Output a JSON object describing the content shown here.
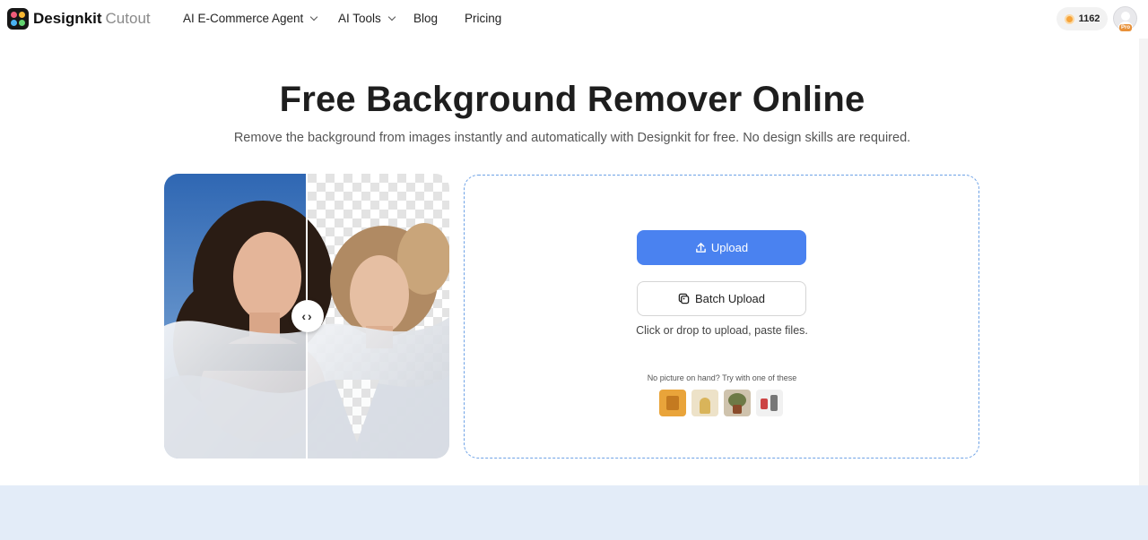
{
  "brand": {
    "name": "Designkit",
    "product": "Cutout"
  },
  "nav": [
    {
      "label": "AI E-Commerce Agent",
      "has_dropdown": true
    },
    {
      "label": "AI Tools",
      "has_dropdown": true
    },
    {
      "label": "Blog",
      "has_dropdown": false
    },
    {
      "label": "Pricing",
      "has_dropdown": false
    }
  ],
  "user": {
    "credits": "1162",
    "badge": "Pro"
  },
  "hero": {
    "title": "Free Background Remover Online",
    "subtitle": "Remove the background from images instantly and automatically with Designkit for free. No design skills are required."
  },
  "upload": {
    "upload_label": "Upload",
    "batch_label": "Batch Upload",
    "hint": "Click or drop to upload, paste files.",
    "samples_prompt": "No picture on hand? Try with one of these"
  },
  "colors": {
    "accent": "#4a82f0",
    "dropzone_border": "#6ea2e6",
    "band": "#e3ecf8",
    "logo_dots": [
      "#f05b7a",
      "#f7b733",
      "#4ab3f4",
      "#63d471"
    ]
  },
  "icons": [
    "upload-icon",
    "batch-upload-icon",
    "coin-icon",
    "chevron-down-icon",
    "compare-arrows-icon",
    "avatar-icon"
  ]
}
